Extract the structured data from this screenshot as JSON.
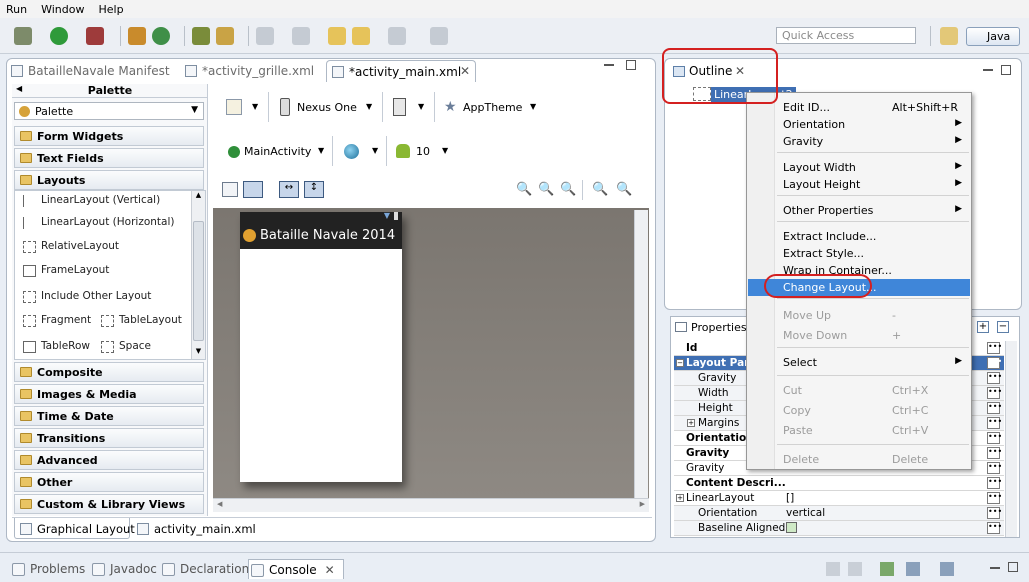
{
  "menu": [
    "Run",
    "Window",
    "Help"
  ],
  "toolbar": {
    "quick_access_placeholder": "Quick Access",
    "perspective": "Java"
  },
  "editor_tabs": [
    {
      "label": "BatailleNavale Manifest",
      "active": false
    },
    {
      "label": "*activity_grille.xml",
      "active": false
    },
    {
      "label": "*activity_main.xml",
      "active": true
    }
  ],
  "palette": {
    "title": "Palette",
    "dropdown": "Palette",
    "categories_top": [
      "Form Widgets",
      "Text Fields",
      "Layouts"
    ],
    "layout_items": [
      {
        "label": "LinearLayout (Vertical)"
      },
      {
        "label": "LinearLayout (Horizontal)"
      },
      {
        "label": "RelativeLayout"
      },
      {
        "label": "FrameLayout"
      },
      {
        "label": "Include Other Layout"
      },
      {
        "label": "Fragment",
        "label2": "TableLayout"
      },
      {
        "label": "TableRow",
        "label2": "Space"
      }
    ],
    "categories_bottom": [
      "Composite",
      "Images & Media",
      "Time & Date",
      "Transitions",
      "Advanced",
      "Other",
      "Custom & Library Views"
    ]
  },
  "editor_toolbar": {
    "device": "Nexus One",
    "theme": "AppTheme",
    "activity": "MainActivity",
    "api": "10"
  },
  "phone": {
    "app_title": "Bataille Navale 2014"
  },
  "editor_bottom_tabs": [
    "Graphical Layout",
    "activity_main.xml"
  ],
  "outline": {
    "title": "Outline",
    "node": "LinearLayout2"
  },
  "context_menu": {
    "items": [
      {
        "label": "Edit ID...",
        "shortcut": "Alt+Shift+R",
        "submenu": false,
        "disabled": false
      },
      {
        "label": "Orientation",
        "shortcut": "",
        "submenu": true,
        "disabled": false
      },
      {
        "label": "Gravity",
        "shortcut": "",
        "submenu": true,
        "disabled": false
      },
      {
        "label": "Layout Width",
        "shortcut": "",
        "submenu": true,
        "disabled": false
      },
      {
        "label": "Layout Height",
        "shortcut": "",
        "submenu": true,
        "disabled": false
      },
      {
        "label": "Other Properties",
        "shortcut": "",
        "submenu": true,
        "disabled": false
      },
      {
        "label": "Extract Include...",
        "shortcut": "",
        "submenu": false,
        "disabled": false
      },
      {
        "label": "Extract Style...",
        "shortcut": "",
        "submenu": false,
        "disabled": false
      },
      {
        "label": "Wrap in Container...",
        "shortcut": "",
        "submenu": false,
        "disabled": false
      },
      {
        "label": "Change Layout...",
        "shortcut": "",
        "submenu": false,
        "disabled": false,
        "highlighted": true
      },
      {
        "label": "Move Up",
        "shortcut": "-",
        "submenu": false,
        "disabled": true
      },
      {
        "label": "Move Down",
        "shortcut": "+",
        "submenu": false,
        "disabled": true
      },
      {
        "label": "Select",
        "shortcut": "",
        "submenu": true,
        "disabled": false
      },
      {
        "label": "Cut",
        "shortcut": "Ctrl+X",
        "submenu": false,
        "disabled": true
      },
      {
        "label": "Copy",
        "shortcut": "Ctrl+C",
        "submenu": false,
        "disabled": true
      },
      {
        "label": "Paste",
        "shortcut": "Ctrl+V",
        "submenu": false,
        "disabled": true
      },
      {
        "label": "Delete",
        "shortcut": "Delete",
        "submenu": false,
        "disabled": true
      }
    ]
  },
  "properties": {
    "title": "Properties",
    "rows": [
      {
        "key": "Id",
        "value": "",
        "bold": true,
        "indent": 0
      },
      {
        "key": "Layout Par",
        "value": "",
        "bold": true,
        "indent": 0,
        "group": true
      },
      {
        "key": "Gravity",
        "value": "",
        "bold": false,
        "indent": 1
      },
      {
        "key": "Width",
        "value": "",
        "bold": false,
        "indent": 1
      },
      {
        "key": "Height",
        "value": "",
        "bold": false,
        "indent": 1
      },
      {
        "key": "Margins",
        "value": "",
        "bold": false,
        "indent": 1,
        "expand": true
      },
      {
        "key": "Orientation",
        "value": "",
        "bold": true,
        "indent": 0
      },
      {
        "key": "Gravity",
        "value": "",
        "bold": true,
        "indent": 0
      },
      {
        "key": "Gravity",
        "value": "",
        "bold": false,
        "indent": 0
      },
      {
        "key": "Content Descri...",
        "value": "",
        "bold": true,
        "indent": 0
      },
      {
        "key": "LinearLayout",
        "value": "[]",
        "bold": false,
        "indent": 0,
        "expand": true
      },
      {
        "key": "Orientation",
        "value": "vertical",
        "bold": false,
        "indent": 1
      },
      {
        "key": "Baseline Aligned",
        "value": "",
        "bold": false,
        "indent": 1
      }
    ]
  },
  "bottom_tabs": [
    {
      "label": "Problems",
      "active": false
    },
    {
      "label": "Javadoc",
      "active": false
    },
    {
      "label": "Declaration",
      "active": false
    },
    {
      "label": "Console",
      "active": true
    }
  ]
}
